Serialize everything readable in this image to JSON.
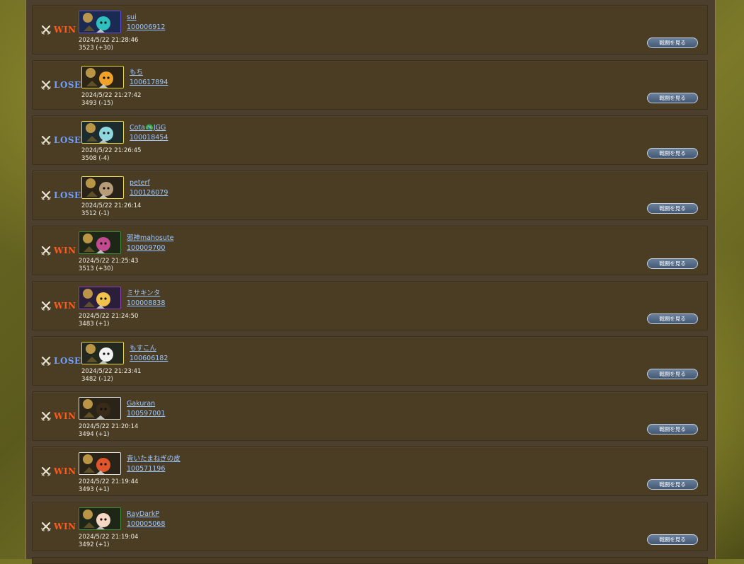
{
  "matches": [
    {
      "result": "WIN",
      "name": "sui",
      "user_id": "100006912",
      "timestamp": "2024/5/22 21:28:46",
      "rating": "3523 (+30)",
      "avatar_border": "#5b4bd6",
      "avatar_bg": "#1b2a52",
      "char_color": "#2fbfbf"
    },
    {
      "result": "LOSE",
      "name": "もち",
      "user_id": "100617894",
      "timestamp": "2024/5/22 21:27:42",
      "rating": "3493 (-15)",
      "avatar_border": "#e8d84a",
      "avatar_bg": "#2c2516",
      "char_color": "#f0a12a"
    },
    {
      "result": "LOSE",
      "name": "Cota🦚JGG",
      "user_id": "100018454",
      "timestamp": "2024/5/22 21:26:45",
      "rating": "3508 (-4)",
      "avatar_border": "#e8d84a",
      "avatar_bg": "#1c2b2e",
      "char_color": "#8fd8e0"
    },
    {
      "result": "LOSE",
      "name": "peterf",
      "user_id": "100126079",
      "timestamp": "2024/5/22 21:26:14",
      "rating": "3512 (-1)",
      "avatar_border": "#e8d84a",
      "avatar_bg": "#2a2418",
      "char_color": "#b89c78"
    },
    {
      "result": "WIN",
      "name": "邪神mahosute",
      "user_id": "100009700",
      "timestamp": "2024/5/22 21:25:43",
      "rating": "3513 (+30)",
      "avatar_border": "#3b8c3b",
      "avatar_bg": "#1e2717",
      "char_color": "#c24a8f"
    },
    {
      "result": "WIN",
      "name": "ミサキンタ",
      "user_id": "100008838",
      "timestamp": "2024/5/22 21:24:50",
      "rating": "3483 (+1)",
      "avatar_border": "#8a3fae",
      "avatar_bg": "#2b1e3a",
      "char_color": "#f2c24a"
    },
    {
      "result": "LOSE",
      "name": "もすこん",
      "user_id": "100606182",
      "timestamp": "2024/5/22 21:23:41",
      "rating": "3482 (-12)",
      "avatar_border": "#e8d84a",
      "avatar_bg": "#23281e",
      "char_color": "#f2f2f2"
    },
    {
      "result": "WIN",
      "name": "Gakuran",
      "user_id": "100597001",
      "timestamp": "2024/5/22 21:20:14",
      "rating": "3494 (+1)",
      "avatar_border": "#e0e0e0",
      "avatar_bg": "#2a2418",
      "char_color": "#3a2a18"
    },
    {
      "result": "WIN",
      "name": "青いたまねぎの皮",
      "user_id": "100571196",
      "timestamp": "2024/5/22 21:19:44",
      "rating": "3493 (+1)",
      "avatar_border": "#e0e0e0",
      "avatar_bg": "#2a2418",
      "char_color": "#e0552a"
    },
    {
      "result": "WIN",
      "name": "RayDarkP",
      "user_id": "100005068",
      "timestamp": "2024/5/22 21:19:04",
      "rating": "3492 (+1)",
      "avatar_border": "#3b8c3b",
      "avatar_bg": "#1e2717",
      "char_color": "#f6d7c3"
    }
  ],
  "view_battle_label": "戦闘を見る",
  "colors": {
    "win": "#ff5a1a",
    "lose": "#6fa0ff",
    "link": "#9ec7ff",
    "button": "#4b5f7a"
  }
}
